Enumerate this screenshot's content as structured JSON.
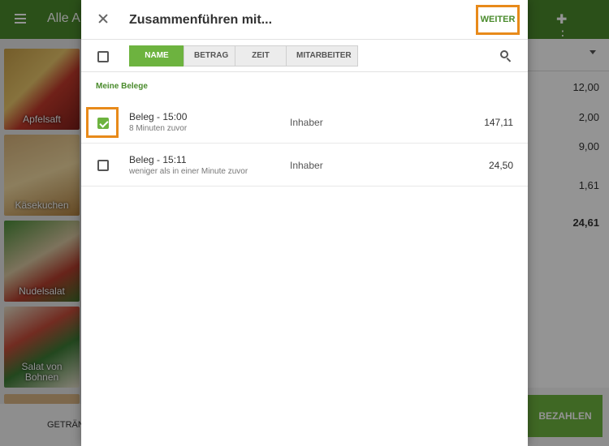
{
  "background": {
    "title": "Alle Ar",
    "tiles": [
      "Apfelsaft",
      "Käsekuchen",
      "Nudelsalat",
      "Salat von Bohnen"
    ],
    "bottom_tab": "GETRÄN",
    "amounts": [
      "12,00",
      "2,00",
      "9,00",
      "1,61",
      "24,61"
    ],
    "pay_label": "BEZAHLEN"
  },
  "dialog": {
    "title": "Zusammenführen mit...",
    "action_label": "WEITER",
    "sort_tabs": [
      "NAME",
      "BETRAG",
      "ZEIT",
      "MITARBEITER"
    ],
    "section_title": "Meine Belege",
    "receipts": [
      {
        "title": "Beleg - 15:00",
        "subtitle": "8 Minuten  zuvor",
        "owner": "Inhaber",
        "amount": "147,11",
        "checked": true
      },
      {
        "title": "Beleg - 15:11",
        "subtitle": "weniger als in einer Minute zuvor",
        "owner": "Inhaber",
        "amount": "24,50",
        "checked": false
      }
    ]
  },
  "colors": {
    "brand_green": "#4a8b2c",
    "accent_green": "#6db33f",
    "highlight_orange": "#e88a1a"
  }
}
